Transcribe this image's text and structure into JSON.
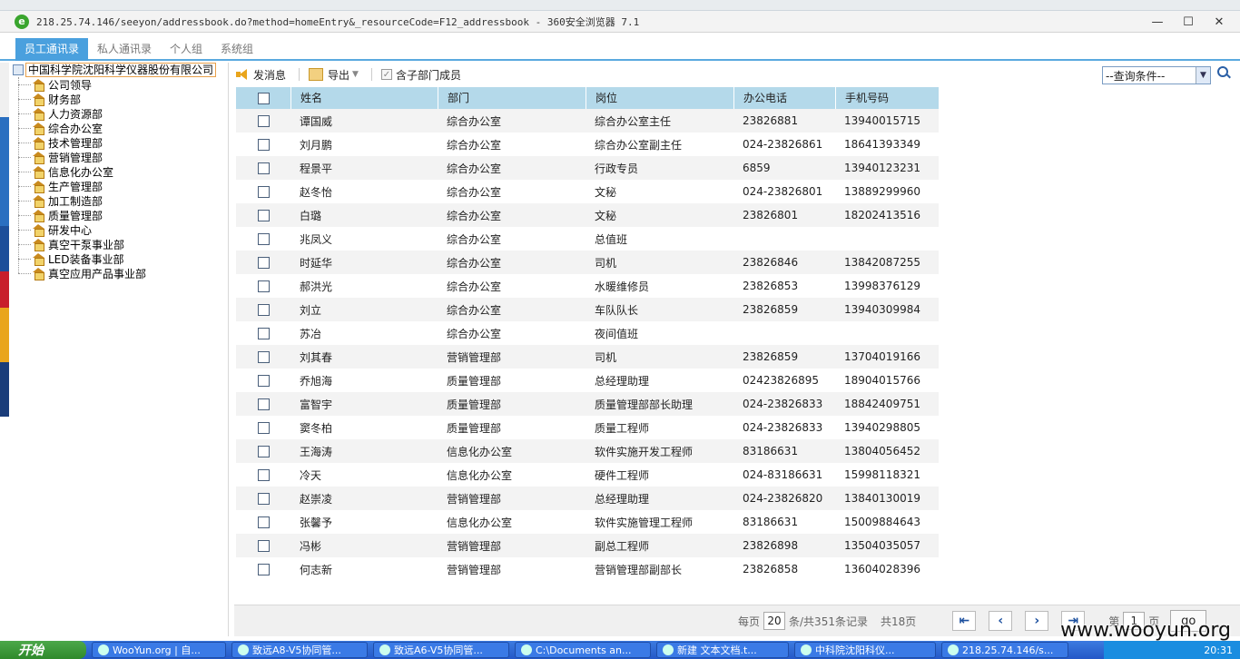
{
  "window": {
    "title": "218.25.74.146/seeyon/addressbook.do?method=homeEntry&_resourceCode=F12_addressbook - 360安全浏览器 7.1",
    "logo_glyph": "e",
    "min": "—",
    "max": "☐",
    "close": "✕"
  },
  "tabs": [
    "员工通讯录",
    "私人通讯录",
    "个人组",
    "系统组"
  ],
  "tree": {
    "root": "中国科学院沈阳科学仪器股份有限公司",
    "items": [
      "公司领导",
      "财务部",
      "人力资源部",
      "综合办公室",
      "技术管理部",
      "营销管理部",
      "信息化办公室",
      "生产管理部",
      "加工制造部",
      "质量管理部",
      "研发中心",
      "真空干泵事业部",
      "LED装备事业部",
      "真空应用产品事业部"
    ]
  },
  "toolbar": {
    "send": "发消息",
    "export": "导出",
    "include_sub": "含子部门成员",
    "query_placeholder": "--查询条件--"
  },
  "table": {
    "headers": [
      "姓名",
      "部门",
      "岗位",
      "办公电话",
      "手机号码"
    ],
    "rows": [
      [
        "谭国威",
        "综合办公室",
        "综合办公室主任",
        "23826881",
        "13940015715"
      ],
      [
        "刘月鹏",
        "综合办公室",
        "综合办公室副主任",
        "024-23826861",
        "18641393349"
      ],
      [
        "程景平",
        "综合办公室",
        "行政专员",
        "6859",
        "13940123231"
      ],
      [
        "赵冬怡",
        "综合办公室",
        "文秘",
        "024-23826801",
        "13889299960"
      ],
      [
        "白璐",
        "综合办公室",
        "文秘",
        "23826801",
        "18202413516"
      ],
      [
        "兆凤义",
        "综合办公室",
        "总值班",
        "",
        ""
      ],
      [
        "时延华",
        "综合办公室",
        "司机",
        "23826846",
        "13842087255"
      ],
      [
        "郝洪光",
        "综合办公室",
        "水暖维修员",
        "23826853",
        "13998376129"
      ],
      [
        "刘立",
        "综合办公室",
        "车队队长",
        "23826859",
        "13940309984"
      ],
      [
        "苏冶",
        "综合办公室",
        "夜间值班",
        "",
        ""
      ],
      [
        "刘其春",
        "营销管理部",
        "司机",
        "23826859",
        "13704019166"
      ],
      [
        "乔旭海",
        "质量管理部",
        "总经理助理",
        "02423826895",
        "18904015766"
      ],
      [
        "富智宇",
        "质量管理部",
        "质量管理部部长助理",
        "024-23826833",
        "18842409751"
      ],
      [
        "窦冬柏",
        "质量管理部",
        "质量工程师",
        "024-23826833",
        "13940298805"
      ],
      [
        "王海涛",
        "信息化办公室",
        "软件实施开发工程师",
        "83186631",
        "13804056452"
      ],
      [
        "冷天",
        "信息化办公室",
        "硬件工程师",
        "024-83186631",
        "15998118321"
      ],
      [
        "赵崇凌",
        "营销管理部",
        "总经理助理",
        "024-23826820",
        "13840130019"
      ],
      [
        "张馨予",
        "信息化办公室",
        "软件实施管理工程师",
        "83186631",
        "15009884643"
      ],
      [
        "冯彬",
        "营销管理部",
        "副总工程师",
        "23826898",
        "13504035057"
      ],
      [
        "何志新",
        "营销管理部",
        "营销管理部副部长",
        "23826858",
        "13604028396"
      ]
    ]
  },
  "pager": {
    "per_page_label": "每页",
    "per_page": "20",
    "total_label": "条/共351条记录",
    "pages_label": "共18页",
    "first": "⇤",
    "prev": "‹",
    "next": "›",
    "last": "⇥",
    "page_prefix": "第",
    "page": "1",
    "page_suffix": "页",
    "go": "go"
  },
  "taskbar": {
    "start": "开始",
    "tasks": [
      "WooYun.org | 自...",
      "致远A8-V5协同管...",
      "致远A6-V5协同管...",
      "C:\\Documents an...",
      "新建 文本文档.t...",
      "中科院沈阳科仪...",
      "218.25.74.146/s..."
    ],
    "clock": "20:31"
  },
  "watermark": "www.wooyun.org"
}
